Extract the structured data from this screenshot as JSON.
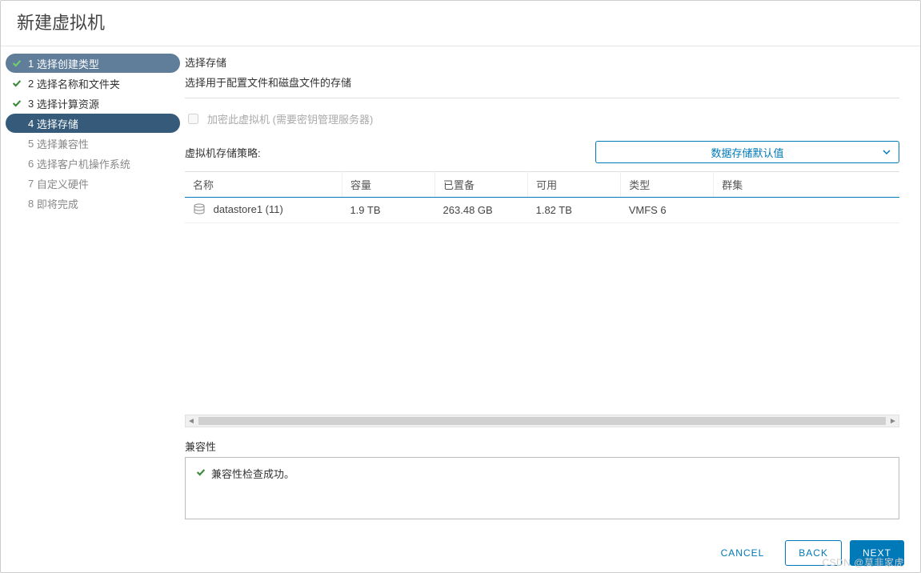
{
  "dialog": {
    "title": "新建虚拟机"
  },
  "steps": [
    {
      "num": "1",
      "label": "选择创建类型",
      "state": "completed-active"
    },
    {
      "num": "2",
      "label": "选择名称和文件夹",
      "state": "completed"
    },
    {
      "num": "3",
      "label": "选择计算资源",
      "state": "completed"
    },
    {
      "num": "4",
      "label": "选择存储",
      "state": "active"
    },
    {
      "num": "5",
      "label": "选择兼容性",
      "state": "pending"
    },
    {
      "num": "6",
      "label": "选择客户机操作系统",
      "state": "pending"
    },
    {
      "num": "7",
      "label": "自定义硬件",
      "state": "pending"
    },
    {
      "num": "8",
      "label": "即将完成",
      "state": "pending"
    }
  ],
  "content": {
    "title": "选择存储",
    "subtitle": "选择用于配置文件和磁盘文件的存储",
    "encrypt_label": "加密此虚拟机 (需要密钥管理服务器)",
    "policy_label": "虚拟机存储策略:",
    "policy_value": "数据存储默认值"
  },
  "table": {
    "headers": {
      "name": "名称",
      "capacity": "容量",
      "provisioned": "已置备",
      "free": "可用",
      "type": "类型",
      "cluster": "群集"
    },
    "rows": [
      {
        "name": "datastore1 (11)",
        "capacity": "1.9 TB",
        "provisioned": "263.48 GB",
        "free": "1.82 TB",
        "type": "VMFS 6",
        "cluster": ""
      }
    ]
  },
  "compat": {
    "label": "兼容性",
    "success": "兼容性检查成功。"
  },
  "footer": {
    "cancel": "CANCEL",
    "back": "BACK",
    "next": "NEXT"
  },
  "watermark": "CSDN @莫非家虎"
}
